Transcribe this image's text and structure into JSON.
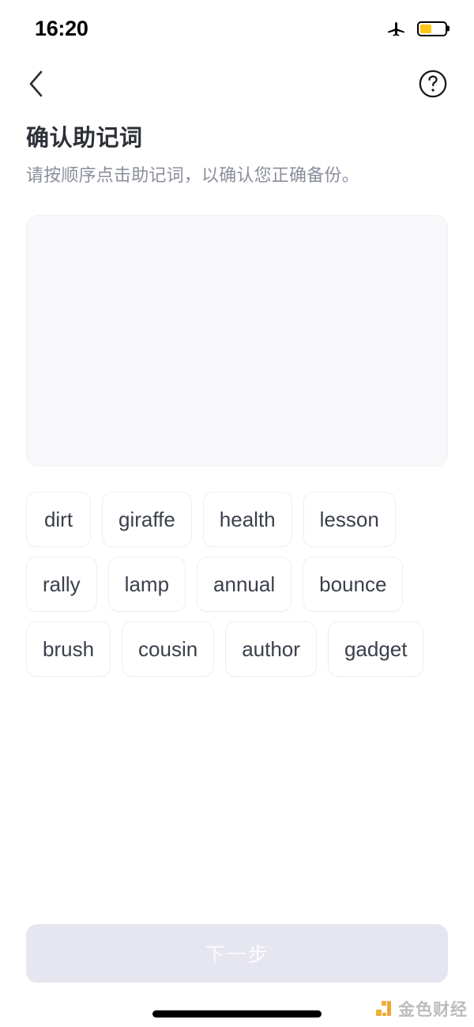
{
  "status_bar": {
    "time": "16:20",
    "airplane_icon": "airplane-icon",
    "battery_icon": "battery-icon",
    "battery_level_percent": 45,
    "battery_color": "#fdc613"
  },
  "nav": {
    "back_icon": "chevron-left-icon",
    "help_icon": "question-circle-icon"
  },
  "header": {
    "title": "确认助记词",
    "subtitle": "请按顺序点击助记词，以确认您正确备份。"
  },
  "answer_panel": {
    "selected_words": [],
    "background_color": "#f8f8fa"
  },
  "word_bank": {
    "words": [
      "dirt",
      "giraffe",
      "health",
      "lesson",
      "rally",
      "lamp",
      "annual",
      "bounce",
      "brush",
      "cousin",
      "author",
      "gadget"
    ]
  },
  "footer": {
    "next_label": "下一步",
    "next_enabled": false,
    "disabled_bg_color": "#e6e6f1",
    "disabled_text_color": "#fbfbfe"
  },
  "watermark": {
    "text": "金色财经",
    "logo_icon": "jinse-logo-icon",
    "logo_color": "#eea32a"
  },
  "home_indicator": "home-indicator-bar"
}
